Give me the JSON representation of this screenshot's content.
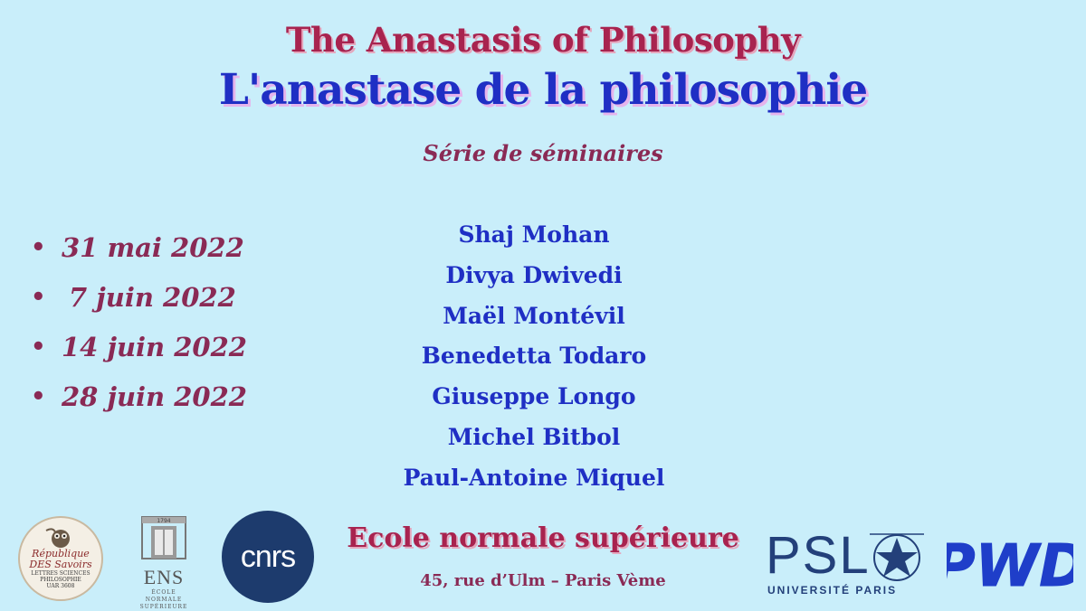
{
  "title_en": "The Anastasis of Philosophy",
  "title_fr": "L'anastase de la philosophie",
  "subtitle": "Série de séminaires",
  "bullet": "•",
  "dates": [
    "31 mai 2022",
    "7 juin 2022",
    "14 juin 2022",
    "28 juin 2022"
  ],
  "speakers": [
    "Shaj Mohan",
    "Divya Dwivedi",
    "Maël Montévil",
    "Benedetta Todaro",
    "Giuseppe Longo",
    "Michel Bitbol",
    "Paul-Antoine Miquel"
  ],
  "venue": "Ecole normale supérieure",
  "address": "45, rue d’Ulm – Paris Vème",
  "logos": {
    "rds": {
      "line1": "République",
      "line2": "DES Savoirs",
      "line3": "LETTRES SCIENCES",
      "line4": "PHILOSOPHIE",
      "line5": "UAR 3608"
    },
    "ens": {
      "year": "1794",
      "name": "ENS",
      "sub1": "ÉCOLE NORMALE",
      "sub2": "SUPÉRIEURE"
    },
    "cnrs": "cnrs",
    "psl": {
      "name": "PSL",
      "sub": "UNIVERSITÉ PARIS"
    },
    "pwd": "PWD"
  },
  "colors": {
    "background": "#c9eefa",
    "crimson": "#a8234f",
    "blue": "#1f2fc4",
    "plum": "#8a2a55"
  }
}
